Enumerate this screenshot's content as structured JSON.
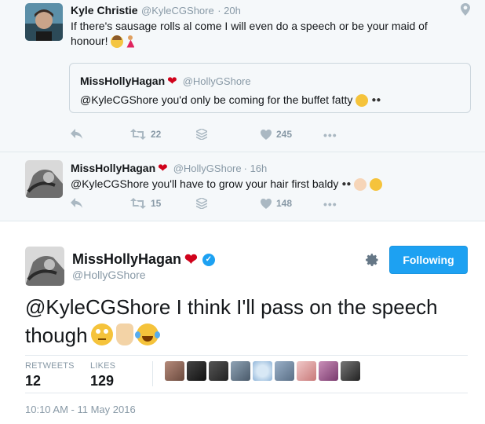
{
  "thread": {
    "tweet1": {
      "name": "Kyle Christie",
      "handle": "@KyleCGShore",
      "time": "· 20h",
      "text_line1": "If there's sausage rolls al come I will even do a speech or be your maid of",
      "text_line2": "honour!",
      "emojis": [
        "woman-tipping-hand-emoji",
        "dancer-emoji"
      ],
      "quote": {
        "name": "MissHollyHagan",
        "handle": "@HollyGShore",
        "text": "@KyleCGShore you'd only be coming for the buffet fatty"
      },
      "retweets": "22",
      "likes": "245"
    },
    "tweet2": {
      "name": "MissHollyHagan",
      "handle": "@HollyGShore",
      "time": "· 16h",
      "text": "@KyleCGShore you'll have to grow your hair first baldy",
      "retweets": "15",
      "likes": "148"
    }
  },
  "main": {
    "name": "MissHollyHagan",
    "handle": "@HollyGShore",
    "follow_label": "Following",
    "text": "@KyleCGShore I think I'll pass on the speech though",
    "emojis": [
      "rolling-eyes-emoji",
      "raised-hand-emoji",
      "tears-of-joy-emoji"
    ],
    "retweets_label": "RETWEETS",
    "retweets": "12",
    "likes_label": "LIKES",
    "likes": "129",
    "timestamp": "10:10 AM - 11 May 2016"
  },
  "colors": {
    "accent": "#1da1f2",
    "heart": "#d0021b",
    "muted": "#8899a6"
  }
}
